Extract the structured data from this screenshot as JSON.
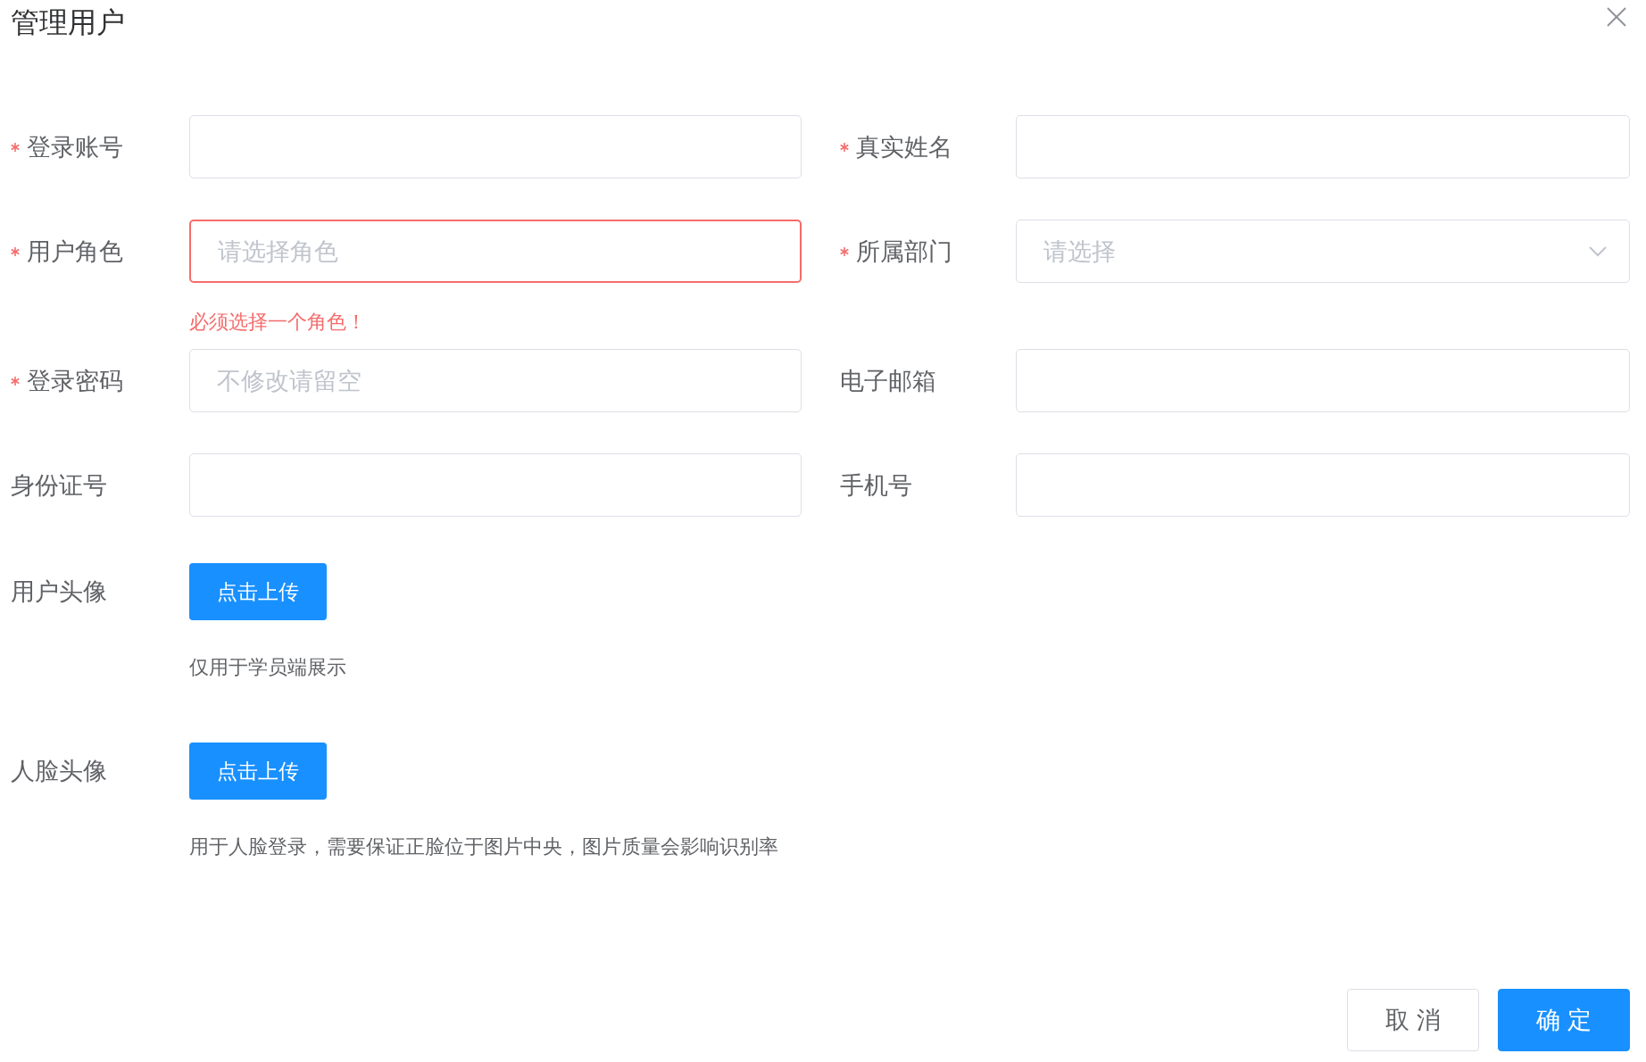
{
  "title": "管理用户",
  "rows": [
    [
      {
        "label": "登录账号",
        "required": true,
        "kind": "input",
        "invalid": false
      },
      {
        "label": "真实姓名",
        "required": true,
        "kind": "input",
        "invalid": false
      }
    ],
    [
      {
        "label": "用户角色",
        "required": true,
        "kind": "input",
        "placeholder": "请选择角色",
        "invalid": true,
        "error": "必须选择一个角色！"
      },
      {
        "label": "所属部门",
        "required": true,
        "kind": "select",
        "placeholder": "请选择"
      }
    ],
    [
      {
        "label": "登录密码",
        "required": true,
        "kind": "input",
        "placeholder": "不修改请留空",
        "invalid": false
      },
      {
        "label": "电子邮箱",
        "required": false,
        "kind": "input",
        "invalid": false
      }
    ],
    [
      {
        "label": "身份证号",
        "required": false,
        "kind": "input",
        "invalid": false
      },
      {
        "label": "手机号",
        "required": false,
        "kind": "input",
        "invalid": false
      }
    ]
  ],
  "uploads": [
    {
      "label": "用户头像",
      "button": "点击上传",
      "hint": "仅用于学员端展示"
    },
    {
      "label": "人脸头像",
      "button": "点击上传",
      "hint": "用于人脸登录，需要保证正脸位于图片中央，图片质量会影响识别率"
    }
  ],
  "buttons": [
    {
      "label": "取 消",
      "kind": "default"
    },
    {
      "label": "确 定",
      "kind": "primary"
    }
  ]
}
